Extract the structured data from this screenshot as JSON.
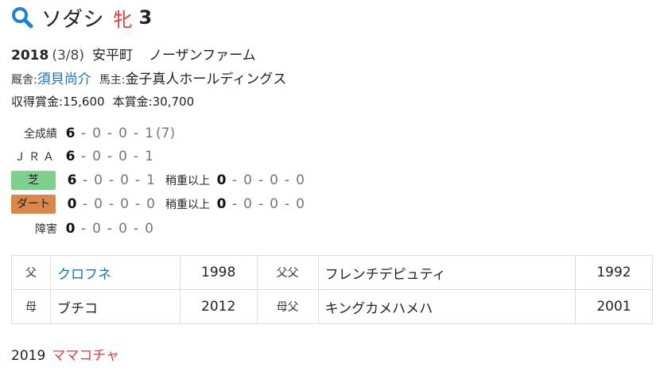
{
  "title": {
    "name": "ソダシ",
    "sex": "牝",
    "age": "3"
  },
  "birth": {
    "year": "2018",
    "date": "(3/8)",
    "place": "安平町",
    "farm": "ノーザンファーム"
  },
  "stable": {
    "trainer_label": "厩舎:",
    "trainer": "須貝尚介",
    "owner_label": "馬主:",
    "owner": "金子真人ホールディングス"
  },
  "earnings": {
    "income_label": "収得賞金:",
    "income": "15,600",
    "prize_label": "本賞金:",
    "prize": "30,700"
  },
  "records": {
    "total": {
      "label": "全成績",
      "w1": "6",
      "w2": "0",
      "w3": "0",
      "w4": "1",
      "extra": "(7)"
    },
    "jra": {
      "label": "ＪＲＡ",
      "w1": "6",
      "w2": "0",
      "w3": "0",
      "w4": "1"
    },
    "turf": {
      "label": "芝",
      "color": "#7fcf8f",
      "w1": "6",
      "w2": "0",
      "w3": "0",
      "w4": "1",
      "heavy_label": "稍重以上",
      "h1": "0",
      "h2": "0",
      "h3": "0",
      "h4": "0"
    },
    "dirt": {
      "label": "ダート",
      "color": "#d9874a",
      "w1": "0",
      "w2": "0",
      "w3": "0",
      "w4": "0",
      "heavy_label": "稍重以上",
      "h1": "0",
      "h2": "0",
      "h3": "0",
      "h4": "0"
    },
    "jump": {
      "label": "障害",
      "w1": "0",
      "w2": "0",
      "w3": "0",
      "w4": "0"
    }
  },
  "pedigree": {
    "sire_label": "父",
    "sire": "クロフネ",
    "sire_year": "1998",
    "sire_sire_label": "父父",
    "sire_sire": "フレンチデピュティ",
    "sire_sire_year": "1992",
    "dam_label": "母",
    "dam": "ブチコ",
    "dam_year": "2012",
    "dam_sire_label": "母父",
    "dam_sire": "キングカメハメハ",
    "dam_sire_year": "2001"
  },
  "foals": {
    "year": "2019",
    "name": "ママコチャ"
  },
  "icons": {
    "search": "search-icon"
  },
  "colors": {
    "accent_red": "#e03a3a",
    "link_blue": "#1a6fc4",
    "search_blue": "#1e7fd8"
  }
}
